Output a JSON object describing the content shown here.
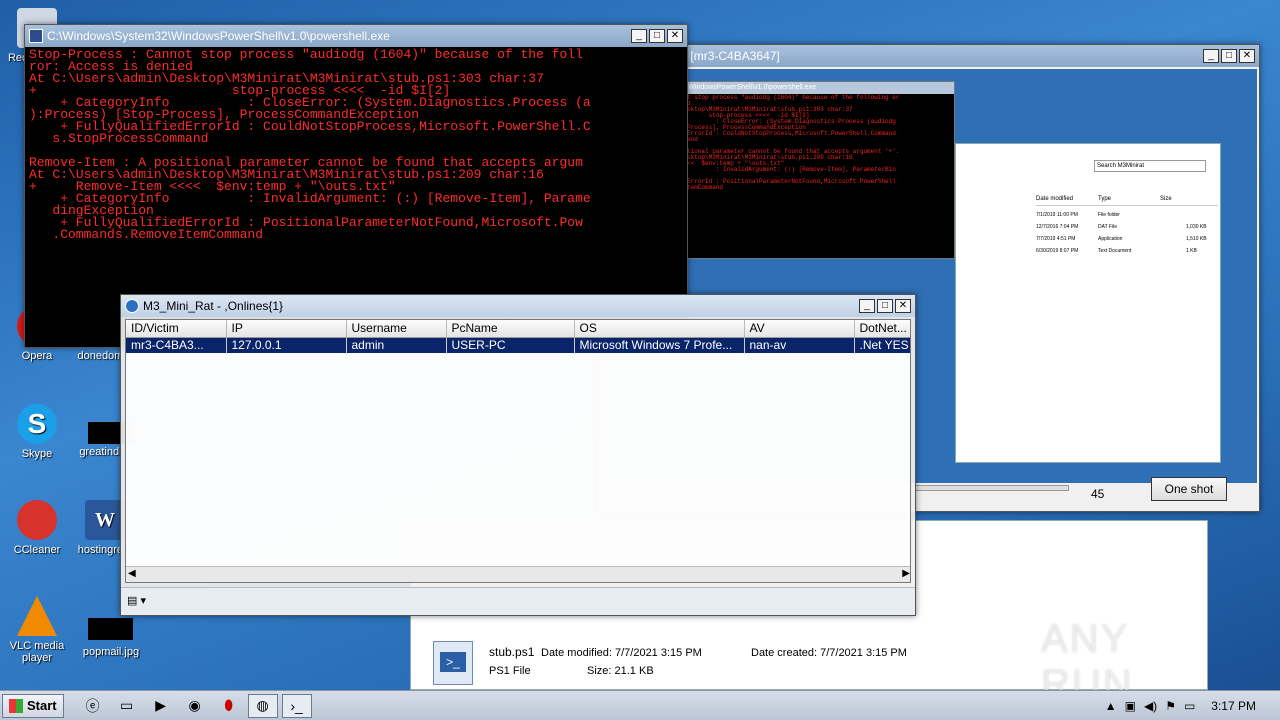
{
  "desktop": {
    "icons": [
      {
        "label": "Recycle Bin"
      },
      {
        "label": "Opera"
      },
      {
        "label": "donedom..."
      },
      {
        "label": "Skype"
      },
      {
        "label": "greatindi..."
      },
      {
        "label": "CCleaner"
      },
      {
        "label": "hostingre..."
      },
      {
        "label": "VLC media player"
      },
      {
        "label": "popmail.jpg"
      }
    ],
    "watermark": "ANY RUN"
  },
  "powershell": {
    "title": "C:\\Windows\\System32\\WindowsPowerShell\\v1.0\\powershell.exe",
    "lines": [
      "Stop-Process : Cannot stop process \"audiodg (1604)\" because of the foll",
      "ror: Access is denied",
      "At C:\\Users\\admin\\Desktop\\M3Minirat\\M3Minirat\\stub.ps1:303 char:37",
      "+                         stop-process <<<<  -id $I[2]",
      "    + CategoryInfo          : CloseError: (System.Diagnostics.Process (a",
      "):Process) [Stop-Process], ProcessCommandException",
      "    + FullyQualifiedErrorId : CouldNotStopProcess,Microsoft.PowerShell.C",
      "   s.StopProcessCommand",
      "",
      "Remove-Item : A positional parameter cannot be found that accepts argum",
      "At C:\\Users\\admin\\Desktop\\M3Minirat\\M3Minirat\\stub.ps1:209 char:16",
      "+     Remove-Item <<<<  $env:temp + \"\\outs.txt\"",
      "    + CategoryInfo          : InvalidArgument: (:) [Remove-Item], Parame",
      "   dingException",
      "    + FullyQualifiedErrorId : PositionalParameterNotFound,Microsoft.Pow",
      "   .Commands.RemoveItemCommand"
    ]
  },
  "screenshot_window": {
    "title": "Screen Shot [mr3-C4BA3647]",
    "slider_value": "45",
    "one_shot_label": "One shot"
  },
  "explorer": {
    "search_placeholder": "Search M3Minirat",
    "columns": [
      "Date modified",
      "Type",
      "Size"
    ],
    "rows": [
      {
        "date": "7/1/2019 11:00 PM",
        "type": "File folder",
        "size": ""
      },
      {
        "date": "12/7/2016 7:04 PM",
        "type": "DAT File",
        "size": "1,030 KB"
      },
      {
        "date": "7/7/2019 4:51 PM",
        "type": "Application",
        "size": "1,510 KB"
      },
      {
        "date": "6/30/2019 8:07 PM",
        "type": "Text Document",
        "size": "1 KB"
      }
    ],
    "details": {
      "name": "stub.ps1",
      "date_modified": "Date modified: 7/7/2021 3:15 PM",
      "date_created": "Date created: 7/7/2021 3:15 PM",
      "type": "PS1 File",
      "size": "Size: 21.1 KB"
    }
  },
  "rat": {
    "title": "M3_Mini_Rat - ,Onlines{1}",
    "columns": [
      "ID/Victim",
      "IP",
      "Username",
      "PcName",
      "OS",
      "AV",
      "DotNet..."
    ],
    "rows": [
      {
        "id": "mr3-C4BA3...",
        "ip": "127.0.0.1",
        "username": "admin",
        "pcname": "USER-PC",
        "os": "Microsoft Windows 7 Profe...",
        "av": "nan-av",
        "dotnet": ".Net YES"
      }
    ]
  },
  "taskbar": {
    "start_label": "Start",
    "clock": "3:17 PM"
  }
}
